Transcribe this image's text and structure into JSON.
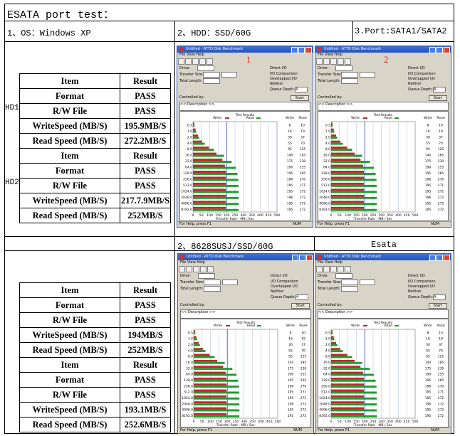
{
  "header": {
    "title": "ESATA port test：",
    "os": "1、OS：Windows XP",
    "hdd": "2、HDD：SSD/60G",
    "port": "3.Port:SATA1/SATA2"
  },
  "section2": {
    "left_caption": "2、8628SUSJ/SSD/60G",
    "right_caption": "Esata"
  },
  "labels": {
    "item": "Item",
    "result": "Result",
    "hd1": "HD1",
    "hd2": "HD2"
  },
  "table1": {
    "hd1": [
      {
        "item": "Format",
        "result": "PASS"
      },
      {
        "item": "R/W File",
        "result": "PASS"
      },
      {
        "item": "WriteSpeed (MB/S)",
        "result": "195.9MB/S"
      },
      {
        "item": "Read  Speed (MB/S)",
        "result": "272.2MB/S"
      }
    ],
    "hd2": [
      {
        "item": "Format",
        "result": "PASS"
      },
      {
        "item": "R/W File",
        "result": "PASS"
      },
      {
        "item": "WriteSpeed (MB/S)",
        "result": "217.7.9MB/S"
      },
      {
        "item": "Read  Speed (MB/S)",
        "result": "252MB/S"
      }
    ]
  },
  "table2": {
    "a": [
      {
        "item": "Format",
        "result": "PASS"
      },
      {
        "item": "R/W File",
        "result": "PASS"
      },
      {
        "item": "WriteSpeed (MB/S)",
        "result": "194MB/S"
      },
      {
        "item": "Read  Speed (MB/S)",
        "result": "252MB/S"
      }
    ],
    "b": [
      {
        "item": "Format",
        "result": "PASS"
      },
      {
        "item": "R/W File",
        "result": "PASS"
      },
      {
        "item": "WriteSpeed (MB/S)",
        "result": "193.1MB/S"
      },
      {
        "item": "Read  Speed (MB/S)",
        "result": "252.6MB/S"
      }
    ]
  },
  "shot_labels": {
    "one": "1",
    "two": "2"
  },
  "bench": {
    "title": "Untitled - ATTO Disk Benchmark",
    "menu": "File  View  Help",
    "drive_label": "Drive:",
    "transfer_label": "Transfer Size:",
    "total_label": "Total Length:",
    "direct_io": "Direct I/O",
    "io_comparison": "I/O Comparison",
    "overlapped": "Overlapped I/O",
    "neither": "Neither",
    "queue_label": "Queue Depth:",
    "queue_value": "4",
    "controlled_by": "Controlled by:",
    "start": "Start",
    "description": "<< Description >>",
    "test_results": "Test Results",
    "write_legend": "Write",
    "read_legend": "Read",
    "xaxis_label": "Transfer Rate - MB / Sec",
    "status": "For Help, press F1",
    "num": "NUM",
    "ticks": [
      "0",
      "50",
      "100",
      "150",
      "200",
      "250",
      "300",
      "350",
      "400",
      "450",
      "500"
    ],
    "sizes": [
      "0.5",
      "1.0",
      "2.0",
      "4.0",
      "8.0",
      "16.0",
      "32.0",
      "64.0",
      "128.0",
      "256.0",
      "512.0",
      "1024.0",
      "2048.0",
      "4096.0",
      "8192.0"
    ],
    "write_values": [
      8,
      16,
      30,
      55,
      95,
      140,
      175,
      190,
      195,
      196,
      195,
      195,
      196,
      195,
      195
    ],
    "read_values": [
      10,
      19,
      37,
      70,
      125,
      185,
      230,
      255,
      265,
      270,
      271,
      272,
      272,
      272,
      272
    ]
  }
}
